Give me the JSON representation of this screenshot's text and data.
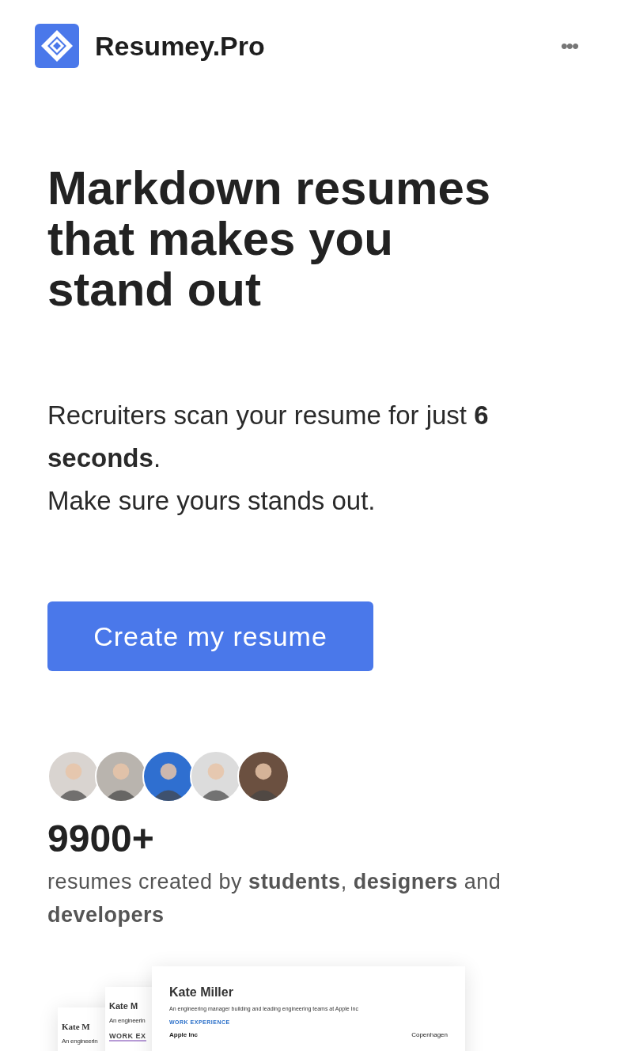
{
  "header": {
    "brand": "Resumey.Pro",
    "menu_icon": "•••"
  },
  "hero": {
    "title": "Markdown resumes that makes you stand out",
    "lines": [
      "Recruiters scan your resume for just **6 seconds**.",
      "Make sure yours stands out."
    ],
    "cta": "Create my resume"
  },
  "social_proof": {
    "avatars": [
      {
        "color": "#d9d4d0"
      },
      {
        "color": "#b9b4ae"
      },
      {
        "color": "#2f6fd0"
      },
      {
        "color": "#dcdcdc"
      },
      {
        "color": "#6b5040"
      }
    ],
    "count": "9900+",
    "caption": "resumes created by **students**, **designers** and **developers**"
  },
  "previews": [
    {
      "kind": "serif",
      "name": "Kate M",
      "summary": "An engineerin"
    },
    {
      "kind": "sans",
      "name": "Kate M",
      "summary": "An engineerin",
      "section": "WORK EX"
    },
    {
      "kind": "front",
      "name": "Kate Miller",
      "summary": "An engineering manager building and leading engineering teams at Apple Inc",
      "section": "WORK EXPERIENCE",
      "company": "Apple Inc",
      "location": "Copenhagen"
    }
  ]
}
